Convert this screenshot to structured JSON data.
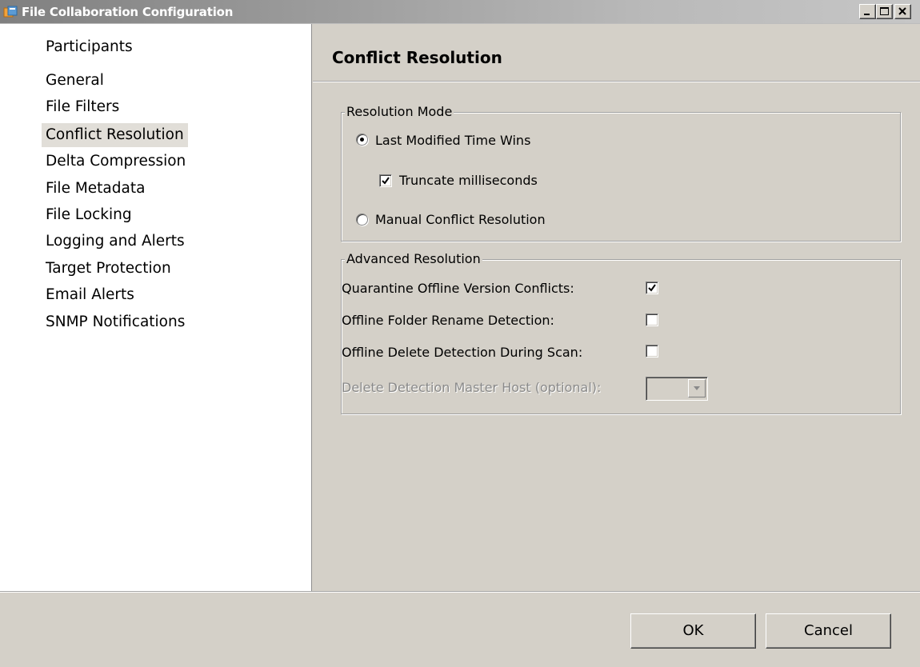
{
  "window": {
    "title": "File Collaboration Configuration",
    "controls": {
      "minimize": "_",
      "maximize": "□",
      "close": "×"
    }
  },
  "nav": {
    "items": [
      {
        "label": "Participants"
      },
      {
        "label": "General"
      },
      {
        "label": "File Filters"
      },
      {
        "label": "Conflict Resolution",
        "selected": true
      },
      {
        "label": "Delta Compression"
      },
      {
        "label": "File Metadata"
      },
      {
        "label": "File Locking"
      },
      {
        "label": "Logging and Alerts"
      },
      {
        "label": "Target Protection"
      },
      {
        "label": "Email Alerts"
      },
      {
        "label": "SNMP Notifications"
      }
    ]
  },
  "main": {
    "title": "Conflict Resolution",
    "resolution_mode": {
      "legend": "Resolution Mode",
      "last_modified": {
        "label": "Last Modified Time Wins",
        "selected": true
      },
      "truncate_ms": {
        "label": "Truncate milliseconds",
        "checked": true
      },
      "manual": {
        "label": "Manual Conflict Resolution",
        "selected": false
      }
    },
    "advanced": {
      "legend": "Advanced Resolution",
      "quarantine": {
        "label": "Quarantine Offline Version Conflicts:",
        "checked": true
      },
      "folder_rename": {
        "label": "Offline Folder Rename Detection:",
        "checked": false
      },
      "delete_detection": {
        "label": "Offline Delete Detection During Scan:",
        "checked": false
      },
      "master_host": {
        "label": "Delete Detection Master Host (optional):",
        "value": "",
        "disabled": true
      }
    }
  },
  "footer": {
    "ok_label": "OK",
    "cancel_label": "Cancel"
  },
  "colors": {
    "face": "#d4d0c8",
    "nav_background": "#ffffff",
    "nav_selected": "#e1ded8",
    "disabled_text": "#8a8a8a"
  }
}
